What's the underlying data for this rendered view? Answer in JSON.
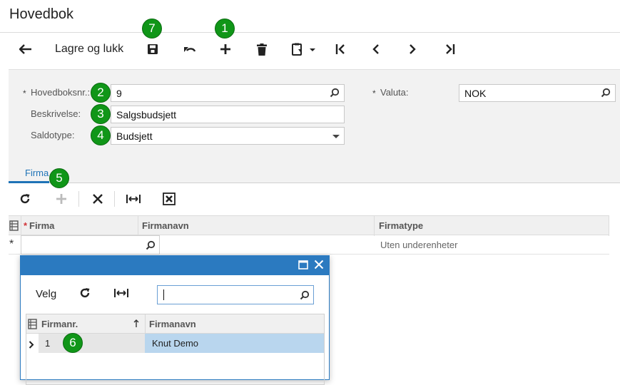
{
  "page": {
    "title": "Hovedbok"
  },
  "toolbar": {
    "save_close_label": "Lagre og lukk",
    "icons": [
      "back-arrow-icon",
      "save-icon",
      "undo-icon",
      "add-icon",
      "delete-icon",
      "clipboard-icon",
      "first-icon",
      "prev-icon",
      "next-icon",
      "last-icon"
    ]
  },
  "badges": {
    "b1": "1",
    "b2": "2",
    "b3": "3",
    "b4": "4",
    "b5": "5",
    "b6": "6",
    "b7": "7"
  },
  "form": {
    "ledger_no": {
      "label": "Hovedboksnr.:",
      "value": "9",
      "required_mark": "*"
    },
    "description": {
      "label": "Beskrivelse:",
      "value": "Salgsbudsjett"
    },
    "balance_type": {
      "label": "Saldotype:",
      "value": "Budsjett"
    },
    "currency": {
      "label": "Valuta:",
      "value": "NOK",
      "required_mark": "*"
    }
  },
  "tabs": [
    {
      "label": "Firma",
      "active": true
    }
  ],
  "grid": {
    "columns": [
      "Firma",
      "Firmanavn",
      "Firmatype"
    ],
    "required_mark": "*",
    "new_row": {
      "marker": "*",
      "firma": "",
      "firmanavn": "",
      "firmatype": "Uten underenheter"
    }
  },
  "popup": {
    "select_label": "Velg",
    "search": {
      "value": ""
    },
    "columns": [
      "Firmanr.",
      "Firmanavn"
    ],
    "rows": [
      {
        "firmanr": "1",
        "firmanavn": "Knut Demo"
      }
    ]
  },
  "colors": {
    "accent": "#1f73b7",
    "badge": "#109618",
    "popup_header": "#2b7ac0",
    "selected_row": "#b9d6ee"
  }
}
